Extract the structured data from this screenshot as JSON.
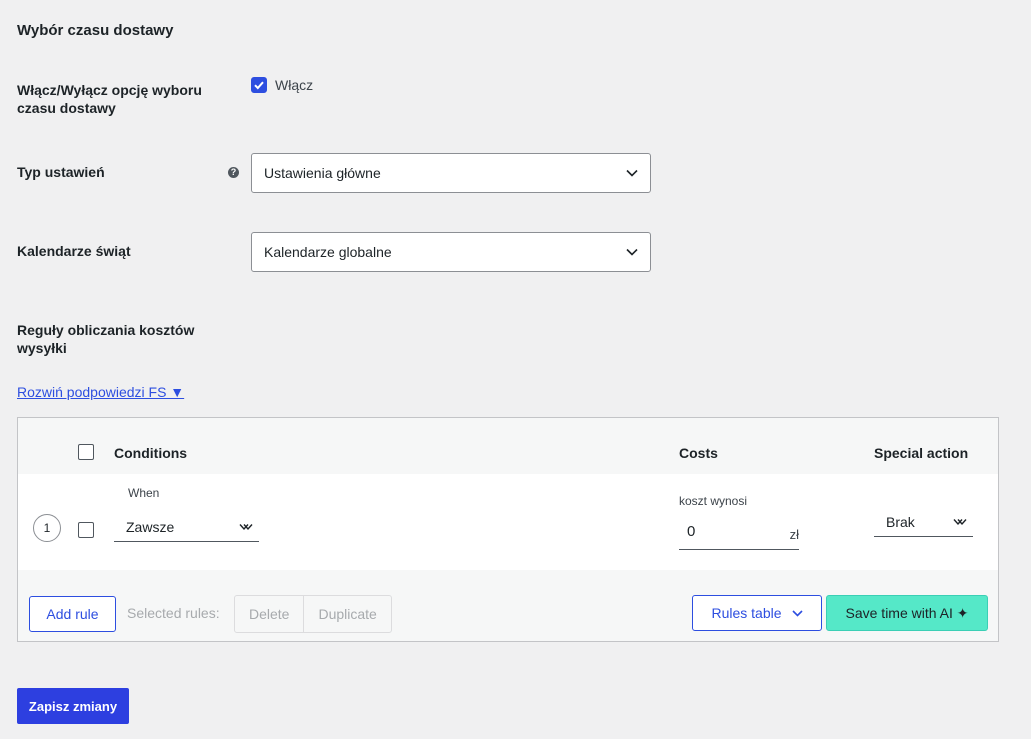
{
  "section": {
    "title": "Wybór czasu dostawy"
  },
  "enable": {
    "label": "Włącz/Wyłącz opcję wyboru czasu dostawy",
    "checkbox_label": "Włącz",
    "checked": true
  },
  "settings_type": {
    "label": "Typ ustawień",
    "help_icon": "?",
    "value": "Ustawienia główne"
  },
  "holiday_calendars": {
    "label": "Kalendarze świąt",
    "value": "Kalendarze globalne"
  },
  "rules": {
    "label": "Reguły obliczania kosztów wysyłki",
    "expand_link": "Rozwiń podpowiedzi FS ▼",
    "table": {
      "headers": {
        "conditions": "Conditions",
        "costs": "Costs",
        "special_action": "Special action"
      },
      "rows": [
        {
          "number": "1",
          "when_label": "When",
          "when_value": "Zawsze",
          "cost_label": "koszt wynosi",
          "cost_value": "0",
          "cost_unit": "zł",
          "special_action": "Brak"
        }
      ],
      "footer": {
        "add_rule": "Add rule",
        "selected_rules_label": "Selected rules:",
        "delete": "Delete",
        "duplicate": "Duplicate",
        "rules_table": "Rules table",
        "save_time_ai": "Save time with AI ✦"
      }
    }
  },
  "save_button": "Zapisz zmiany",
  "colors": {
    "accent": "#2d4ee0",
    "ai_button": "#55e8c8",
    "background": "#f0f0f1"
  }
}
